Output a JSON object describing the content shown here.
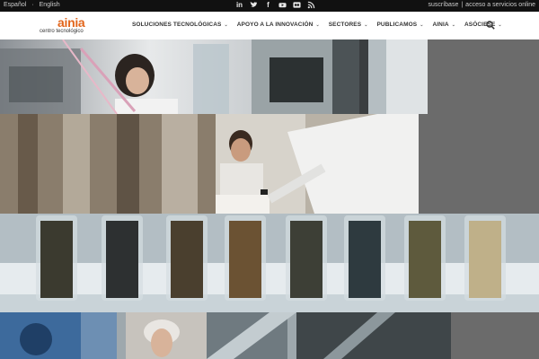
{
  "topbar": {
    "lang_es": "Español",
    "lang_en": "English",
    "subscribe": "suscríbase",
    "divider": "|",
    "online": "acceso a servicios online",
    "social": [
      "linkedin-icon",
      "twitter-icon",
      "facebook-icon",
      "youtube-icon",
      "flickr-icon",
      "rss-icon"
    ]
  },
  "logo": {
    "word": "ainia",
    "sub": "centro tecnológico"
  },
  "nav": [
    {
      "label": "SOLUCIONES TECNOLÓGICAS"
    },
    {
      "label": "APOYO A LA INNOVACIÓN"
    },
    {
      "label": "SECTORES"
    },
    {
      "label": "PUBLICAMOS"
    },
    {
      "label": "AINIA"
    },
    {
      "label": "ASÓCIESE"
    }
  ],
  "colors": {
    "brand": "#e2651b",
    "topbar": "#111111",
    "bg": "#6b6b6b"
  }
}
